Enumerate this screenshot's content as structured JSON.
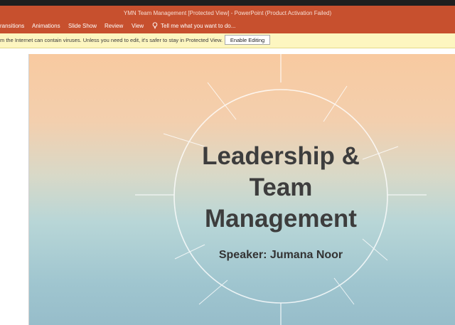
{
  "window": {
    "title": "YMN Team Management [Protected View] - PowerPoint (Product Activation Failed)"
  },
  "ribbon": {
    "tabs": [
      {
        "label": "ransitions"
      },
      {
        "label": "Animations"
      },
      {
        "label": "Slide Show"
      },
      {
        "label": "Review"
      },
      {
        "label": "View"
      }
    ],
    "tell_me": "Tell me what you want to do...",
    "tell_me_icon": "lightbulb-icon"
  },
  "protected_view": {
    "message": "m the Internet can contain viruses. Unless you need to edit, it's safer to stay in Protected View.",
    "enable_button": "Enable Editing"
  },
  "slide": {
    "title_lines": [
      "Leadership &",
      "Team",
      "Management"
    ],
    "subtitle": "Speaker: Jumana Noor"
  },
  "colors": {
    "accent": "#c7502e",
    "message_bar": "#fdf6c0"
  }
}
